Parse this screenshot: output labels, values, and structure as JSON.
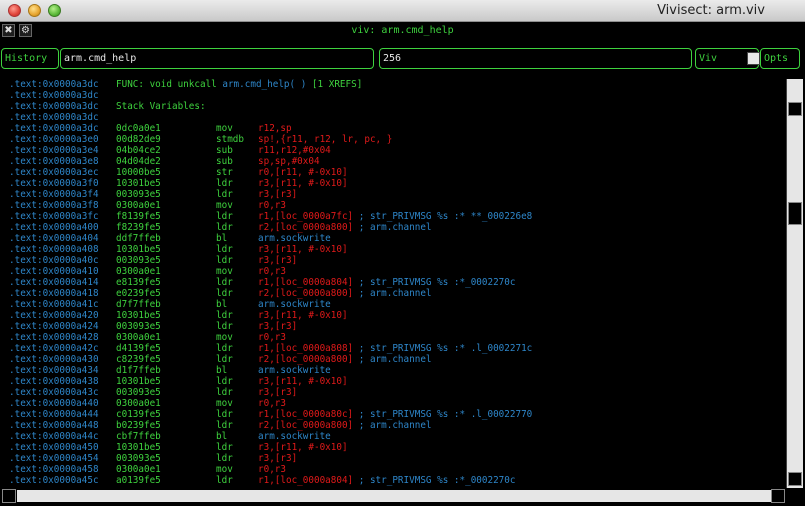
{
  "window": {
    "title": "Vivisect: arm.viv"
  },
  "topbar": {
    "label": "viv: arm.cmd_help",
    "close_glyph": "✖",
    "gear_glyph": "⚙"
  },
  "toolbar": {
    "history_label": "History",
    "expression_value": "arm.cmd_help",
    "size_value": "256",
    "viv_label": "Viv",
    "opts_label": "Opts"
  },
  "colors": {
    "address": "#2e86c9",
    "code": "#3ed23e",
    "operand": "#e01a1a",
    "comment": "#2e86c9"
  },
  "header_lines": [
    {
      "addr": ".text:0x0000a3dc",
      "text": "FUNC: void unkcall ",
      "fname": "arm.cmd_help( )",
      "extra": " [1 XREFS]"
    },
    {
      "addr": ".text:0x0000a3dc",
      "text": "",
      "fname": "",
      "extra": ""
    },
    {
      "addr": ".text:0x0000a3dc",
      "text": "Stack Variables:",
      "fname": "",
      "extra": ""
    },
    {
      "addr": ".text:0x0000a3dc",
      "text": "",
      "fname": "",
      "extra": ""
    }
  ],
  "lines": [
    {
      "addr": ".text:0x0000a3dc",
      "hex": "0dc0a0e1",
      "mn": "mov",
      "ops": "r12,sp",
      "cm": ""
    },
    {
      "addr": ".text:0x0000a3e0",
      "hex": "00d82de9",
      "mn": "stmdb",
      "ops": "sp!,{r11, r12, lr, pc, }",
      "cm": ""
    },
    {
      "addr": ".text:0x0000a3e4",
      "hex": "04b04ce2",
      "mn": "sub",
      "ops": "r11,r12,#0x04",
      "cm": ""
    },
    {
      "addr": ".text:0x0000a3e8",
      "hex": "04d04de2",
      "mn": "sub",
      "ops": "sp,sp,#0x04",
      "cm": ""
    },
    {
      "addr": ".text:0x0000a3ec",
      "hex": "10000be5",
      "mn": "str",
      "ops": "r0,[r11, #-0x10]",
      "cm": ""
    },
    {
      "addr": ".text:0x0000a3f0",
      "hex": "10301be5",
      "mn": "ldr",
      "ops": "r3,[r11, #-0x10]",
      "cm": ""
    },
    {
      "addr": ".text:0x0000a3f4",
      "hex": "003093e5",
      "mn": "ldr",
      "ops": "r3,[r3]",
      "cm": ""
    },
    {
      "addr": ".text:0x0000a3f8",
      "hex": "0300a0e1",
      "mn": "mov",
      "ops": "r0,r3",
      "cm": ""
    },
    {
      "addr": ".text:0x0000a3fc",
      "hex": "f8139fe5",
      "mn": "ldr",
      "ops": "r1,[loc_0000a7fc]",
      "cm": " ; str_PRIVMSG %s :* **_000226e8"
    },
    {
      "addr": ".text:0x0000a400",
      "hex": "f8239fe5",
      "mn": "ldr",
      "ops": "r2,[loc_0000a800]",
      "cm": " ; arm.channel"
    },
    {
      "addr": ".text:0x0000a404",
      "hex": "ddf7ffeb",
      "mn": "bl",
      "ops": "arm.sockwrite",
      "cm": ""
    },
    {
      "addr": ".text:0x0000a408",
      "hex": "10301be5",
      "mn": "ldr",
      "ops": "r3,[r11, #-0x10]",
      "cm": ""
    },
    {
      "addr": ".text:0x0000a40c",
      "hex": "003093e5",
      "mn": "ldr",
      "ops": "r3,[r3]",
      "cm": ""
    },
    {
      "addr": ".text:0x0000a410",
      "hex": "0300a0e1",
      "mn": "mov",
      "ops": "r0,r3",
      "cm": ""
    },
    {
      "addr": ".text:0x0000a414",
      "hex": "e8139fe5",
      "mn": "ldr",
      "ops": "r1,[loc_0000a804]",
      "cm": " ; str_PRIVMSG %s :*_0002270c"
    },
    {
      "addr": ".text:0x0000a418",
      "hex": "e0239fe5",
      "mn": "ldr",
      "ops": "r2,[loc_0000a800]",
      "cm": " ; arm.channel"
    },
    {
      "addr": ".text:0x0000a41c",
      "hex": "d7f7ffeb",
      "mn": "bl",
      "ops": "arm.sockwrite",
      "cm": ""
    },
    {
      "addr": ".text:0x0000a420",
      "hex": "10301be5",
      "mn": "ldr",
      "ops": "r3,[r11, #-0x10]",
      "cm": ""
    },
    {
      "addr": ".text:0x0000a424",
      "hex": "003093e5",
      "mn": "ldr",
      "ops": "r3,[r3]",
      "cm": ""
    },
    {
      "addr": ".text:0x0000a428",
      "hex": "0300a0e1",
      "mn": "mov",
      "ops": "r0,r3",
      "cm": ""
    },
    {
      "addr": ".text:0x0000a42c",
      "hex": "d4139fe5",
      "mn": "ldr",
      "ops": "r1,[loc_0000a808]",
      "cm": " ; str_PRIVMSG %s :* .l_0002271c"
    },
    {
      "addr": ".text:0x0000a430",
      "hex": "c8239fe5",
      "mn": "ldr",
      "ops": "r2,[loc_0000a800]",
      "cm": " ; arm.channel"
    },
    {
      "addr": ".text:0x0000a434",
      "hex": "d1f7ffeb",
      "mn": "bl",
      "ops": "arm.sockwrite",
      "cm": ""
    },
    {
      "addr": ".text:0x0000a438",
      "hex": "10301be5",
      "mn": "ldr",
      "ops": "r3,[r11, #-0x10]",
      "cm": ""
    },
    {
      "addr": ".text:0x0000a43c",
      "hex": "003093e5",
      "mn": "ldr",
      "ops": "r3,[r3]",
      "cm": ""
    },
    {
      "addr": ".text:0x0000a440",
      "hex": "0300a0e1",
      "mn": "mov",
      "ops": "r0,r3",
      "cm": ""
    },
    {
      "addr": ".text:0x0000a444",
      "hex": "c0139fe5",
      "mn": "ldr",
      "ops": "r1,[loc_0000a80c]",
      "cm": " ; str_PRIVMSG %s :* .l_00022770"
    },
    {
      "addr": ".text:0x0000a448",
      "hex": "b0239fe5",
      "mn": "ldr",
      "ops": "r2,[loc_0000a800]",
      "cm": " ; arm.channel"
    },
    {
      "addr": ".text:0x0000a44c",
      "hex": "cbf7ffeb",
      "mn": "bl",
      "ops": "arm.sockwrite",
      "cm": ""
    },
    {
      "addr": ".text:0x0000a450",
      "hex": "10301be5",
      "mn": "ldr",
      "ops": "r3,[r11, #-0x10]",
      "cm": ""
    },
    {
      "addr": ".text:0x0000a454",
      "hex": "003093e5",
      "mn": "ldr",
      "ops": "r3,[r3]",
      "cm": ""
    },
    {
      "addr": ".text:0x0000a458",
      "hex": "0300a0e1",
      "mn": "mov",
      "ops": "r0,r3",
      "cm": ""
    },
    {
      "addr": ".text:0x0000a45c",
      "hex": "a0139fe5",
      "mn": "ldr",
      "ops": "r1,[loc_0000a804]",
      "cm": " ; str_PRIVMSG %s :*_0002270c"
    }
  ]
}
